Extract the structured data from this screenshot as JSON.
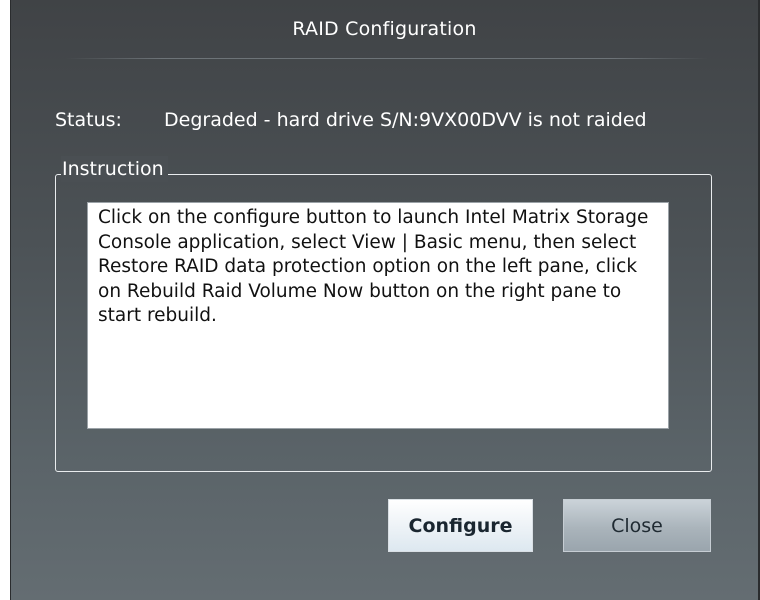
{
  "window": {
    "title": "RAID Configuration"
  },
  "status": {
    "label": "Status:",
    "value": "Degraded - hard drive S/N:9VX00DVV is not raided"
  },
  "instruction": {
    "legend": "Instruction",
    "text": "Click on the configure button to launch Intel Matrix Storage Console application, select View | Basic menu, then select Restore RAID data protection option on the left pane, click on Rebuild Raid Volume Now button on the right pane to start rebuild."
  },
  "buttons": {
    "configure_label": "Configure",
    "close_label": "Close"
  },
  "colors": {
    "dialog_background_top": "#404346",
    "dialog_background_bottom": "#646d72",
    "text": "#ffffff"
  }
}
